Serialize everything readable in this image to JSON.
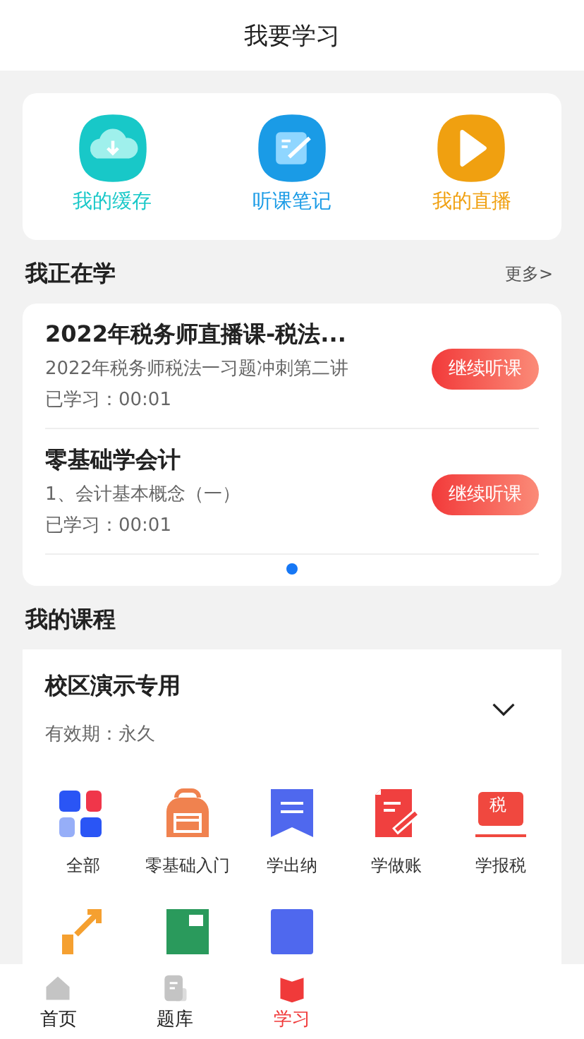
{
  "header": {
    "title": "我要学习"
  },
  "shortcuts": [
    {
      "kind": "cache",
      "label": "我的缓存",
      "color": "#18c8c8"
    },
    {
      "kind": "notes",
      "label": "听课笔记",
      "color": "#1a9be6"
    },
    {
      "kind": "live",
      "label": "我的直播",
      "color": "#f0a010"
    }
  ],
  "studying": {
    "title": "我正在学",
    "more": "更多>",
    "items": [
      {
        "title": "2022年税务师直播课-税法...",
        "subtitle": "2022年税务师税法一习题冲刺第二讲",
        "progress": "已学习：00:01",
        "button": "继续听课"
      },
      {
        "title": "零基础学会计",
        "subtitle": "1、会计基本概念（一）",
        "progress": "已学习：00:01",
        "button": "继续听课"
      }
    ],
    "pages": [
      {
        "selected": true
      }
    ]
  },
  "courses": {
    "title": "我的课程",
    "course": {
      "name": "校区演示专用",
      "validity": "有效期：永久",
      "expanded": false
    },
    "categories": [
      {
        "kind": "all",
        "label": "全部"
      },
      {
        "kind": "backpack",
        "label": "零基础入门"
      },
      {
        "kind": "bookmark",
        "label": "学出纳"
      },
      {
        "kind": "document",
        "label": "学做账"
      },
      {
        "kind": "tax",
        "label": "学报税",
        "badge": "税"
      }
    ],
    "more_categories": [
      {
        "kind": "growth"
      },
      {
        "kind": "sheet"
      },
      {
        "kind": "book"
      }
    ]
  },
  "tab_bar": [
    {
      "kind": "home",
      "label": "首页",
      "selected": false
    },
    {
      "kind": "questions",
      "label": "题库",
      "selected": false
    },
    {
      "kind": "study",
      "label": "学习",
      "selected": true
    }
  ]
}
